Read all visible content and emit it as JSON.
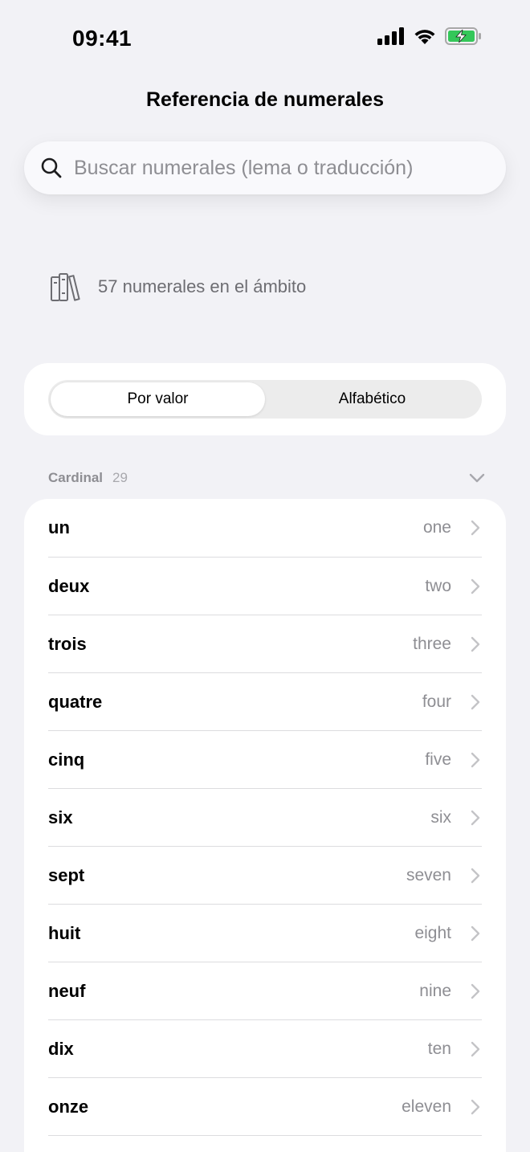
{
  "status_bar": {
    "time": "09:41"
  },
  "header": {
    "title": "Referencia de numerales"
  },
  "search": {
    "placeholder": "Buscar numerales (lema o traducción)",
    "value": ""
  },
  "scope": {
    "count_text": "57 numerales en el ámbito",
    "icon": "books-icon"
  },
  "sort": {
    "options": [
      "Por valor",
      "Alfabético"
    ],
    "selected": "Por valor"
  },
  "section": {
    "title": "Cardinal",
    "count": "29",
    "expanded": true
  },
  "items": [
    {
      "lemma": "un",
      "translation": "one"
    },
    {
      "lemma": "deux",
      "translation": "two"
    },
    {
      "lemma": "trois",
      "translation": "three"
    },
    {
      "lemma": "quatre",
      "translation": "four"
    },
    {
      "lemma": "cinq",
      "translation": "five"
    },
    {
      "lemma": "six",
      "translation": "six"
    },
    {
      "lemma": "sept",
      "translation": "seven"
    },
    {
      "lemma": "huit",
      "translation": "eight"
    },
    {
      "lemma": "neuf",
      "translation": "nine"
    },
    {
      "lemma": "dix",
      "translation": "ten"
    },
    {
      "lemma": "onze",
      "translation": "eleven"
    }
  ],
  "colors": {
    "background": "#f2f2f6",
    "card": "#ffffff",
    "secondary_text": "#8e8e93",
    "battery_green": "#34c759"
  }
}
